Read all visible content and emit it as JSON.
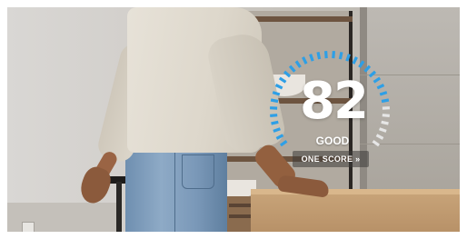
{
  "score": {
    "value": "82",
    "rating": "GOOD",
    "fraction": 0.82
  },
  "cta": {
    "label": "ONE SCORE »"
  },
  "colors": {
    "gauge_active": "#2e9fe6",
    "gauge_inactive": "#e6e6e6",
    "text": "#ffffff"
  }
}
